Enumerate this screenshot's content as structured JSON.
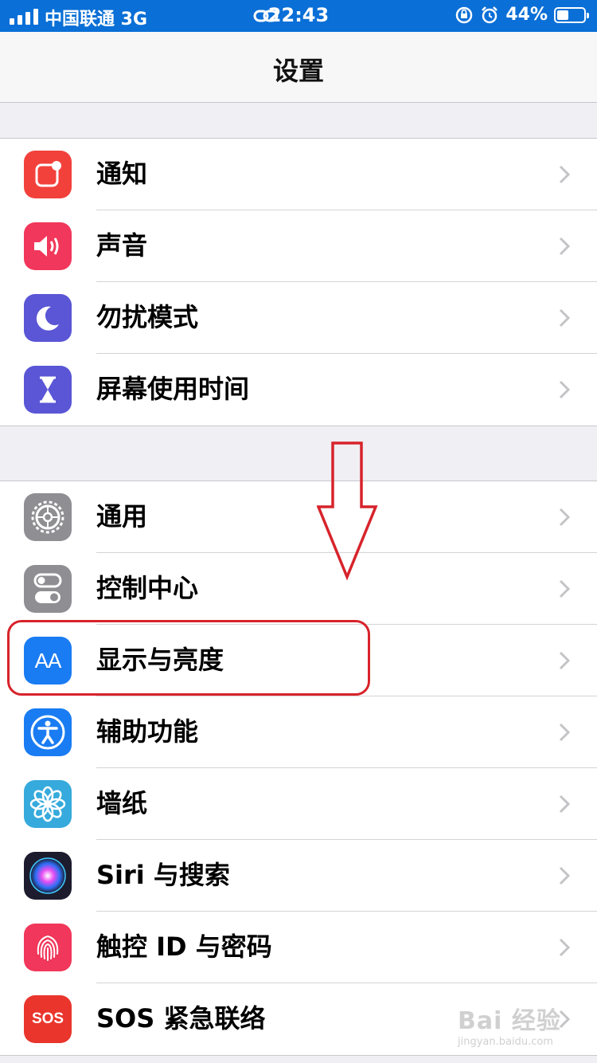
{
  "status_bar": {
    "carrier": "中国联通   3G",
    "time": "22:43",
    "battery_percent": "44%",
    "battery_level": 0.44,
    "icons": [
      "signal-icon",
      "link-icon",
      "rotation-lock-icon",
      "alarm-icon",
      "battery-icon"
    ]
  },
  "nav": {
    "title": "设置"
  },
  "groups": [
    {
      "items": [
        {
          "label": "通知",
          "icon": "notifications-icon",
          "color": "#f2413b"
        },
        {
          "label": "声音",
          "icon": "sounds-icon",
          "color": "#f1375b"
        },
        {
          "label": "勿扰模式",
          "icon": "moon-icon",
          "color": "#5a56d6"
        },
        {
          "label": "屏幕使用时间",
          "icon": "hourglass-icon",
          "color": "#5a56d6"
        }
      ]
    },
    {
      "items": [
        {
          "label": "通用",
          "icon": "gear-icon",
          "color": "#8e8e93"
        },
        {
          "label": "控制中心",
          "icon": "toggles-icon",
          "color": "#8e8e93"
        },
        {
          "label": "显示与亮度",
          "icon": "text-size-icon",
          "color": "#1a7cf2"
        },
        {
          "label": "辅助功能",
          "icon": "accessibility-icon",
          "color": "#1a7cf2"
        },
        {
          "label": "墙纸",
          "icon": "flower-icon",
          "color": "#36aadc"
        },
        {
          "label": "Siri 与搜索",
          "icon": "siri-icon",
          "color": "#1c1c2e"
        },
        {
          "label": "触控 ID 与密码",
          "icon": "fingerprint-icon",
          "color": "#f1375b"
        },
        {
          "label": "SOS 紧急联络",
          "icon": "sos-icon",
          "color": "#e9352c",
          "icon_text": "SOS"
        }
      ]
    }
  ],
  "icon_glyphs": {
    "text_size": "AA"
  },
  "annotation": {
    "color": "#d7232b"
  },
  "watermark": {
    "brand": "Bai  经验",
    "url": "jingyan.baidu.com"
  }
}
